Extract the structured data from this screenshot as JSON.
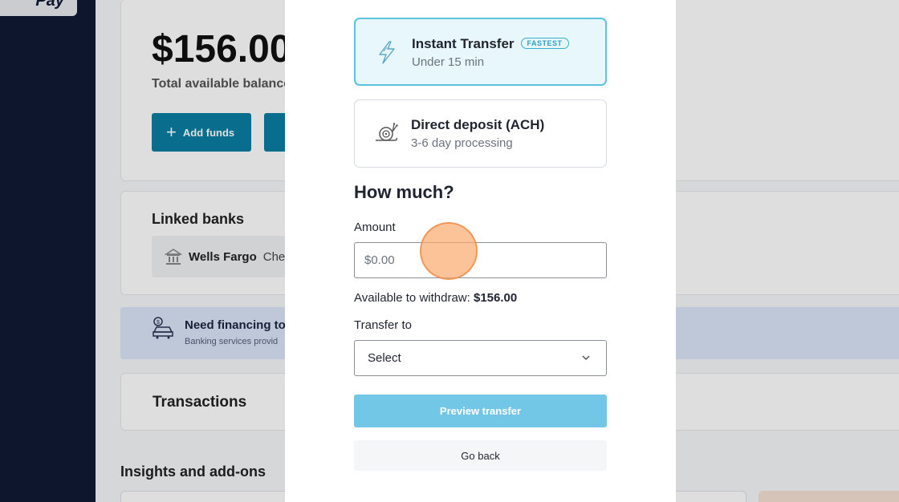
{
  "logo": {
    "text": "Pay"
  },
  "balance": {
    "amount": "$156.00",
    "label": "Total available balance"
  },
  "actions": {
    "add_funds": "Add funds"
  },
  "linked_banks": {
    "title": "Linked banks",
    "bank_name": "Wells Fargo",
    "bank_type": "Che"
  },
  "financing": {
    "title": "Need financing to",
    "subtitle": "Banking services provid"
  },
  "transactions": {
    "title": "Transactions"
  },
  "insights": {
    "title": "Insights and add-ons"
  },
  "modal": {
    "options": [
      {
        "title": "Instant Transfer",
        "badge": "FASTEST",
        "subtitle": "Under 15 min",
        "icon": "lightning-icon",
        "selected": true
      },
      {
        "title": "Direct deposit (ACH)",
        "subtitle": "3-6 day processing",
        "icon": "snail-icon",
        "selected": false
      }
    ],
    "heading": "How much?",
    "amount_label": "Amount",
    "amount_placeholder": "$0.00",
    "available_label": "Available to withdraw:",
    "available_value": "$156.00",
    "transfer_to_label": "Transfer to",
    "transfer_to_value": "Select",
    "preview_button": "Preview transfer",
    "back_button": "Go back"
  },
  "colors": {
    "primary": "#0b7fa3",
    "accent": "#5cc3df",
    "preview_button": "#72c6e6",
    "sidebar": "#0f1a33"
  }
}
